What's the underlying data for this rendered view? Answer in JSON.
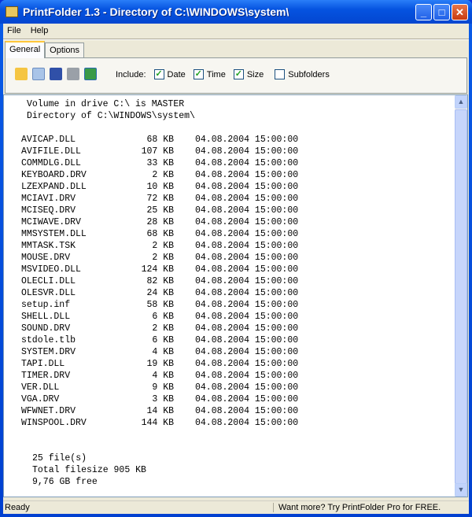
{
  "window": {
    "title": "PrintFolder 1.3 - Directory of C:\\WINDOWS\\system\\"
  },
  "menu": {
    "file": "File",
    "help": "Help"
  },
  "tabs": {
    "general": "General",
    "options": "Options"
  },
  "toolbar": {
    "include_label": "Include:",
    "date": "Date",
    "time": "Time",
    "size": "Size",
    "subfolders": "Subfolders",
    "date_checked": true,
    "time_checked": true,
    "size_checked": true,
    "subfolders_checked": false
  },
  "listing": {
    "volume_line": "Volume in drive C:\\ is MASTER",
    "directory_line": "Directory of C:\\WINDOWS\\system\\",
    "files": [
      {
        "name": "AVICAP.DLL",
        "size": "68 KB",
        "date": "04.08.2004 15:00:00"
      },
      {
        "name": "AVIFILE.DLL",
        "size": "107 KB",
        "date": "04.08.2004 15:00:00"
      },
      {
        "name": "COMMDLG.DLL",
        "size": "33 KB",
        "date": "04.08.2004 15:00:00"
      },
      {
        "name": "KEYBOARD.DRV",
        "size": "2 KB",
        "date": "04.08.2004 15:00:00"
      },
      {
        "name": "LZEXPAND.DLL",
        "size": "10 KB",
        "date": "04.08.2004 15:00:00"
      },
      {
        "name": "MCIAVI.DRV",
        "size": "72 KB",
        "date": "04.08.2004 15:00:00"
      },
      {
        "name": "MCISEQ.DRV",
        "size": "25 KB",
        "date": "04.08.2004 15:00:00"
      },
      {
        "name": "MCIWAVE.DRV",
        "size": "28 KB",
        "date": "04.08.2004 15:00:00"
      },
      {
        "name": "MMSYSTEM.DLL",
        "size": "68 KB",
        "date": "04.08.2004 15:00:00"
      },
      {
        "name": "MMTASK.TSK",
        "size": "2 KB",
        "date": "04.08.2004 15:00:00"
      },
      {
        "name": "MOUSE.DRV",
        "size": "2 KB",
        "date": "04.08.2004 15:00:00"
      },
      {
        "name": "MSVIDEO.DLL",
        "size": "124 KB",
        "date": "04.08.2004 15:00:00"
      },
      {
        "name": "OLECLI.DLL",
        "size": "82 KB",
        "date": "04.08.2004 15:00:00"
      },
      {
        "name": "OLESVR.DLL",
        "size": "24 KB",
        "date": "04.08.2004 15:00:00"
      },
      {
        "name": "setup.inf",
        "size": "58 KB",
        "date": "04.08.2004 15:00:00"
      },
      {
        "name": "SHELL.DLL",
        "size": "6 KB",
        "date": "04.08.2004 15:00:00"
      },
      {
        "name": "SOUND.DRV",
        "size": "2 KB",
        "date": "04.08.2004 15:00:00"
      },
      {
        "name": "stdole.tlb",
        "size": "6 KB",
        "date": "04.08.2004 15:00:00"
      },
      {
        "name": "SYSTEM.DRV",
        "size": "4 KB",
        "date": "04.08.2004 15:00:00"
      },
      {
        "name": "TAPI.DLL",
        "size": "19 KB",
        "date": "04.08.2004 15:00:00"
      },
      {
        "name": "TIMER.DRV",
        "size": "4 KB",
        "date": "04.08.2004 15:00:00"
      },
      {
        "name": "VER.DLL",
        "size": "9 KB",
        "date": "04.08.2004 15:00:00"
      },
      {
        "name": "VGA.DRV",
        "size": "3 KB",
        "date": "04.08.2004 15:00:00"
      },
      {
        "name": "WFWNET.DRV",
        "size": "14 KB",
        "date": "04.08.2004 15:00:00"
      },
      {
        "name": "WINSPOOL.DRV",
        "size": "144 KB",
        "date": "04.08.2004 15:00:00"
      }
    ],
    "file_count": "25 file(s)",
    "total": "Total filesize 905 KB",
    "free": "9,76 GB free"
  },
  "status": {
    "left": "Ready",
    "right": "Want more? Try PrintFolder Pro for FREE."
  }
}
